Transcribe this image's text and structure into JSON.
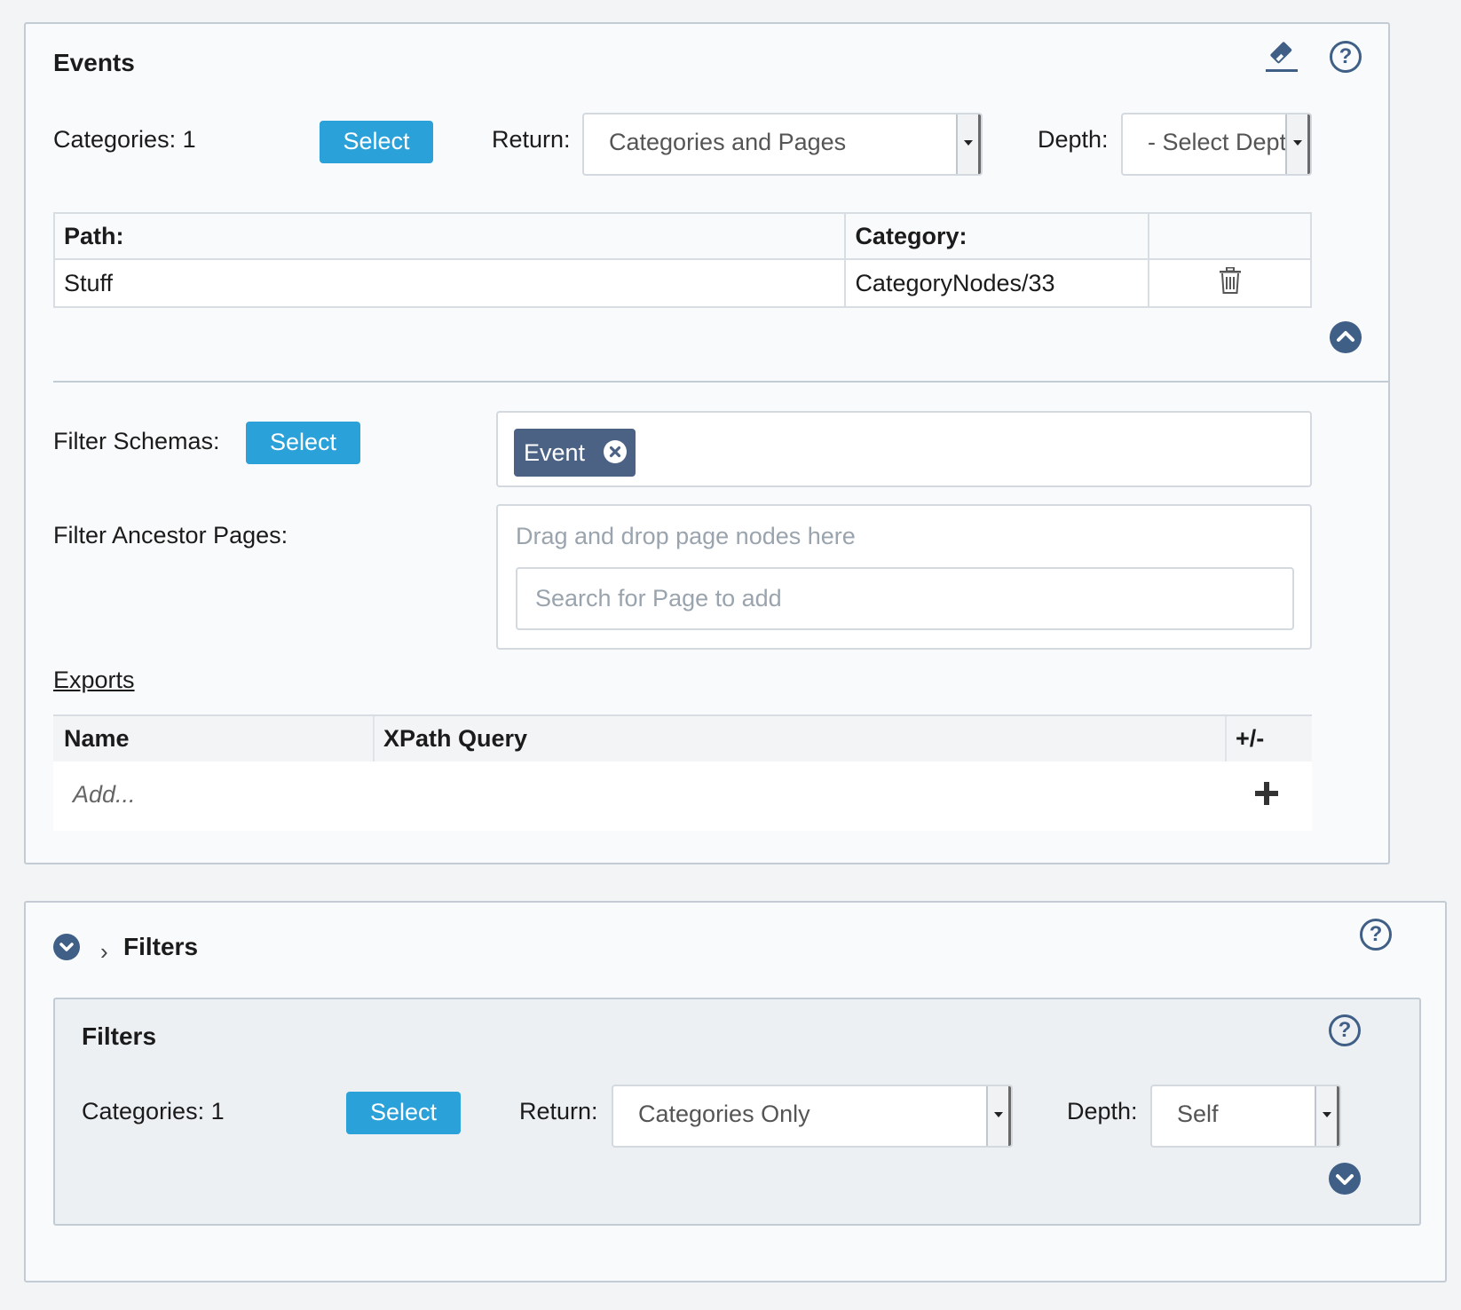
{
  "events": {
    "title": "Events",
    "categories_label": "Categories: 1",
    "select_label": "Select",
    "return_label": "Return:",
    "return_value": "Categories and Pages",
    "depth_label": "Depth:",
    "depth_value": "- Select Depth -",
    "table": {
      "headers": [
        "Path:",
        "Category:",
        ""
      ],
      "rows": [
        {
          "path": "Stuff",
          "category": "CategoryNodes/33"
        }
      ]
    },
    "filter_schemas_label": "Filter Schemas:",
    "filter_schemas_select": "Select",
    "schema_tags": [
      "Event"
    ],
    "filter_ancestor_label": "Filter Ancestor Pages:",
    "drop_hint": "Drag and drop page nodes here",
    "search_placeholder": "Search for Page to add",
    "exports_label": "Exports",
    "exports_table": {
      "headers": [
        "Name",
        "XPath Query",
        "+/-"
      ],
      "add_placeholder": "Add..."
    }
  },
  "filters_section": {
    "breadcrumb_title": "Filters",
    "inner": {
      "title": "Filters",
      "categories_label": "Categories: 1",
      "select_label": "Select",
      "return_label": "Return:",
      "return_value": "Categories Only",
      "depth_label": "Depth:",
      "depth_value": "Self"
    }
  },
  "colors": {
    "accent_blue": "#2aa1d8",
    "icon_navy": "#3f5f86",
    "tag_bg": "#4b6284"
  }
}
